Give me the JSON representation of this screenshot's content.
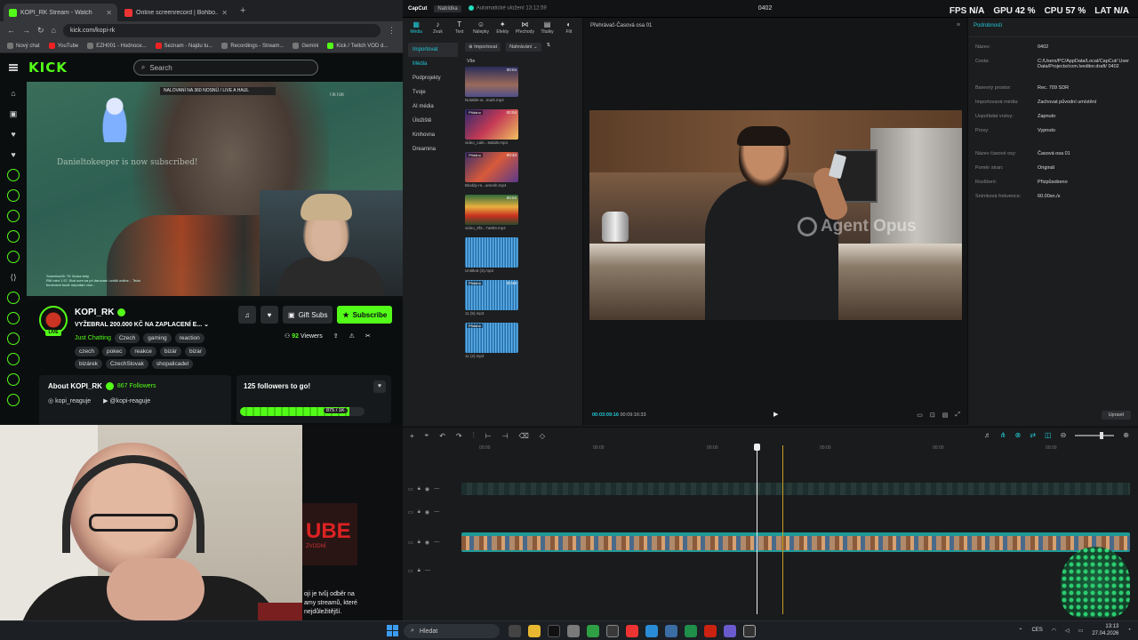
{
  "overlay_stats": [
    {
      "label": "FPS",
      "value": "N/A"
    },
    {
      "label": "GPU",
      "value": "42 %"
    },
    {
      "label": "CPU",
      "value": "57 %"
    },
    {
      "label": "LAT",
      "value": "N/A"
    }
  ],
  "browser": {
    "tabs": [
      {
        "title": "KOPI_RK Stream - Watch"
      },
      {
        "title": "Online screenrecord | Bohbo..."
      }
    ],
    "url": "kick.com/kopi-rk",
    "bookmarks": [
      "Nový chat",
      "YouTube",
      "EZH001 - Hodnoce...",
      "Seznam - Najdu tu...",
      "Recordings - Stream...",
      "Gemini",
      "Kick / Twitch VOD d..."
    ]
  },
  "kick": {
    "logo": "KICK",
    "search_placeholder": "Search",
    "video": {
      "banner": "NALOVANÍ NA 360 NOSNÚ / LIVE A HAUL",
      "sub_notice_name": "Danieltokeeper",
      "sub_notice_text": " is now subscribed!",
      "tiktok": "TikTok",
      "chat_line1": "Somebro26: Tě Zuzka tedy",
      "chat_line2": "RM mint 1.57: Bud som sa pri darovaní uvidíš online... Teda",
      "chat_line3": "fumerami bude nepodarí více..."
    },
    "streamer": {
      "name": "KOPI_RK",
      "live": "LIVE",
      "title": "VYŽEBRAL 200.000 KČ NA ZAPLACENÍ E...",
      "category": "Just Chatting",
      "tags_row0": [
        "Czech",
        "gaming",
        "reaction"
      ],
      "tags_row1": [
        "czech",
        "pokec",
        "reakce",
        "bizár",
        "bizar"
      ],
      "tags_row2": [
        "bizárek",
        "CzechSlovak",
        "shopalicadel"
      ],
      "gift_label": "Gift Subs",
      "subscribe_label": "Subscribe",
      "viewers": "92",
      "viewers_label": "Viewers"
    },
    "about": {
      "title": "About KOPI_RK",
      "followers": "867",
      "followers_label": "Followers",
      "social1": "kopi_reaguje",
      "social2": "@kopi-reaguje"
    },
    "goal": {
      "title": "125 followers to go!",
      "progress_label": "875 / 1K",
      "progress_fraction": 0.875
    }
  },
  "midpanel": {
    "logo_text": "UBE",
    "logo_sub": "ZVODNÍ",
    "promo_line1": "oji je tvůj odběr na",
    "promo_line2": "amy streamů, které",
    "promo_line3": "nejdůležitější."
  },
  "capcut": {
    "app_name": "CapCut",
    "menu": "Nabídka",
    "autosave": "Automatické uložení 13:12:59",
    "project_title": "0402",
    "tools": [
      {
        "label": "Média",
        "glyph": "▦"
      },
      {
        "label": "Zvuk",
        "glyph": "♪"
      },
      {
        "label": "Text",
        "glyph": "T"
      },
      {
        "label": "Nálepky",
        "glyph": "☺"
      },
      {
        "label": "Efekty",
        "glyph": "✦"
      },
      {
        "label": "Přechody",
        "glyph": "⋈"
      },
      {
        "label": "Titulky",
        "glyph": "▤"
      },
      {
        "label": "Filt",
        "glyph": "◐"
      }
    ],
    "nav": [
      "Importovat",
      "Média",
      "Podprojekty",
      "Tvoje",
      "AI média",
      "Úložiště",
      "Knihovna",
      "Dreamina"
    ],
    "media_import": "Importovat",
    "media_sort": "Nahrávání",
    "media_all": "Vše",
    "media_items": [
      {
        "name": "Notable-w...mark.mp4",
        "duration": "00:04",
        "tag": ""
      },
      {
        "name": "video_014...2x234.mp4",
        "duration": "",
        "tag": ""
      },
      {
        "name": "video_cafe...9abd6.mp4",
        "duration": "00:04",
        "tag": "Přidáno"
      },
      {
        "name": "Bloddy-re...amesh.mp4",
        "duration": "00:34",
        "tag": "Přidáno"
      },
      {
        "name": "video_9f3...7a893.mp4",
        "duration": "00:04",
        "tag": ""
      },
      {
        "name": "Untitled (3).mp3",
        "duration": "",
        "tag": ""
      },
      {
        "name": "11 (5).mp3",
        "duration": "00:48",
        "tag": "Přidáno"
      },
      {
        "name": "11 (2).mp3",
        "duration": "",
        "tag": "Přidáno"
      }
    ],
    "player_title": "Přehrávač-Časová osa 01",
    "watermark": "Agent Opus",
    "time_current": "00:03:09:16",
    "time_total": "00:09:16:33",
    "props_header": "Podrobnosti",
    "props": [
      {
        "k": "Název:",
        "v": "0402"
      },
      {
        "k": "Cesta:",
        "v": "C:/Users/PC/AppData/Local/CapCut/ User Data/Projects/com.lveditor.draft/ 0402"
      },
      {
        "k": "Barevný prostor:",
        "v": "Rec. 709 SDR"
      },
      {
        "k": "Importovaná média:",
        "v": "Zachovat původní umístění"
      },
      {
        "k": "Uspořádat vrstvy:",
        "v": "Zapnuto"
      },
      {
        "k": "Proxy:",
        "v": "Vypnuto"
      },
      {
        "k": "Název časové osy:",
        "v": "Časová osa 01"
      },
      {
        "k": "Poměr stran:",
        "v": "Originál"
      },
      {
        "k": "Rozlišení:",
        "v": "Přizpůsobeno"
      },
      {
        "k": "Snímková frekvence:",
        "v": "60.00sn./s"
      }
    ],
    "props_button": "Upravit",
    "ruler": [
      "00:00",
      "00:00",
      "00:00",
      "00:00",
      "00:00",
      "00:00"
    ]
  },
  "taskbar": {
    "search_placeholder": "Hledat",
    "lang": "CES",
    "time": "13:13",
    "date": "27.04.2026"
  }
}
